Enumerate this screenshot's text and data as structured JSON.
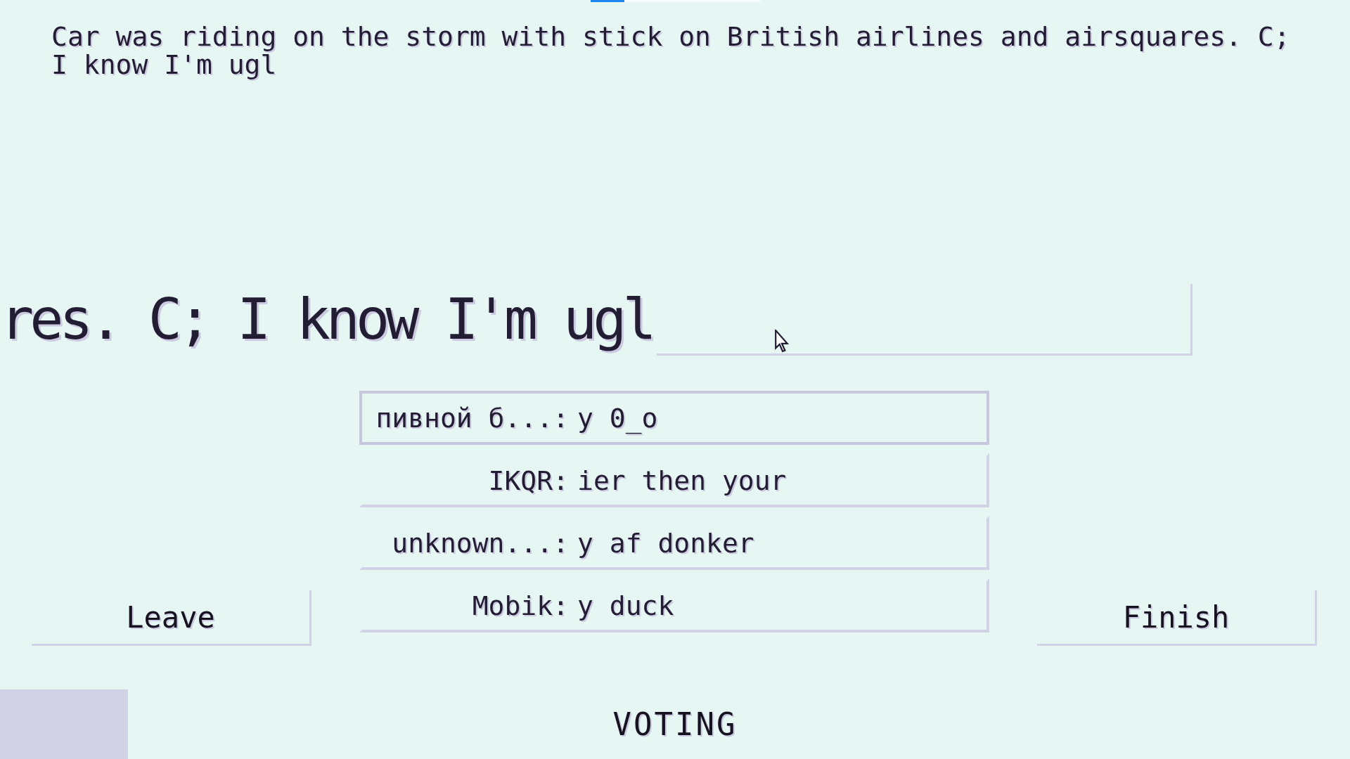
{
  "timer": {
    "level": 0.2
  },
  "prompt": "Car was riding on the storm with stick on British airlines and airsquares. C; I know I'm ugl",
  "answer_input": {
    "value": "res. C; I know I'm ugl"
  },
  "options": [
    {
      "author": "пивной б...:",
      "message": "y 0_o",
      "selected": true
    },
    {
      "author": "IKQR:",
      "message": "ier then your",
      "selected": false
    },
    {
      "author": "unknown...:",
      "message": "y af donker",
      "selected": false
    },
    {
      "author": "Mobik:",
      "message": "y duck",
      "selected": false
    }
  ],
  "leave_button": "Leave",
  "finish_button": "Finish",
  "phase": "VOTING"
}
